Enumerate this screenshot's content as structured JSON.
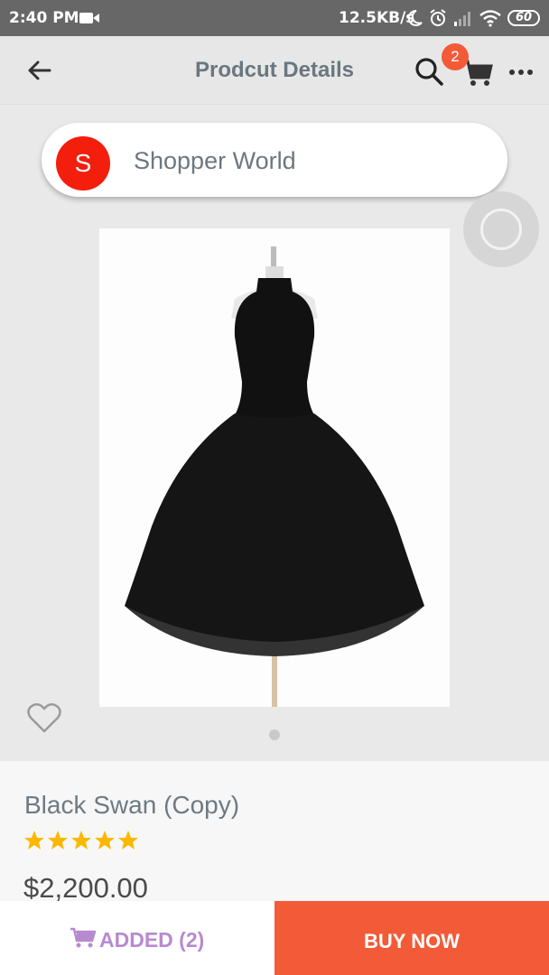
{
  "status_bar": {
    "time": "2:40 PM",
    "network_speed": "12.5KB/s",
    "battery": "60",
    "icons": [
      "video-camera-icon",
      "moon-icon",
      "alarm-icon",
      "signal-icon",
      "wifi-icon",
      "battery-icon"
    ]
  },
  "header": {
    "title": "Prodcut Details",
    "cart_count": "2",
    "icons": [
      "back-arrow-icon",
      "search-icon",
      "cart-icon",
      "more-icon"
    ]
  },
  "shop": {
    "avatar_letter": "S",
    "name": "Shopper World",
    "avatar_color": "#f31e0c"
  },
  "product": {
    "name": "Black Swan (Copy)",
    "rating": 5,
    "rating_max": 5,
    "price": "$2,200.00",
    "image_pages": 1,
    "image_page_current": 1
  },
  "actions": {
    "added_label": "ADDED (2)",
    "buy_label": "BUY NOW"
  },
  "colors": {
    "accent": "#f35a38",
    "added_text": "#b78ad0",
    "star": "#fbb800",
    "title_text": "#6a7780"
  }
}
